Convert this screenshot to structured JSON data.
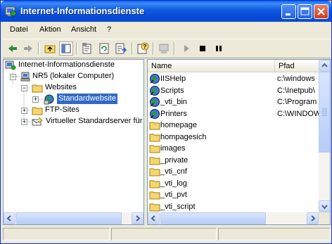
{
  "window": {
    "title": "Internet-Informationsdienste",
    "colors": {
      "titlebar": "#0a4bd0",
      "selection": "#316ac5",
      "folder": "#f7d66b"
    }
  },
  "menu": [
    "Datei",
    "Aktion",
    "Ansicht",
    "?"
  ],
  "tree": [
    {
      "label": "Internet-Informationsdienste",
      "icon": "iis-icon"
    },
    {
      "label": "NR5 (lokaler Computer)",
      "icon": "computer-icon",
      "expander": "−"
    },
    {
      "label": "Websites",
      "icon": "folder-icon",
      "expander": "−"
    },
    {
      "label": "Standardwebsite",
      "icon": "globe-icon",
      "expander": "+",
      "selected": true
    },
    {
      "label": "FTP-Sites",
      "icon": "folder-icon",
      "expander": "+"
    },
    {
      "label": "Virtueller Standardserver für",
      "icon": "smtp-server-icon",
      "expander": "+"
    }
  ],
  "list": {
    "columns": [
      "Name",
      "Pfad"
    ],
    "rows": [
      {
        "name": "IISHelp",
        "path": "c:\\windows",
        "icon": "virtual-dir-icon"
      },
      {
        "name": "Scripts",
        "path": "C:\\Inetpub\\",
        "icon": "virtual-dir-icon"
      },
      {
        "name": "_vti_bin",
        "path": "C:\\Program",
        "icon": "virtual-dir-icon"
      },
      {
        "name": "Printers",
        "path": "C:\\WINDOW",
        "icon": "virtual-dir-icon"
      },
      {
        "name": "homepage",
        "path": "",
        "icon": "folder-icon"
      },
      {
        "name": "hompagesich",
        "path": "",
        "icon": "folder-icon"
      },
      {
        "name": "images",
        "path": "",
        "icon": "folder-icon"
      },
      {
        "name": "_private",
        "path": "",
        "icon": "folder-icon"
      },
      {
        "name": "_vti_cnf",
        "path": "",
        "icon": "folder-icon"
      },
      {
        "name": "_vti_log",
        "path": "",
        "icon": "folder-icon"
      },
      {
        "name": "_vti_pvt",
        "path": "",
        "icon": "folder-icon"
      },
      {
        "name": "_vti_script",
        "path": "",
        "icon": "folder-icon"
      }
    ]
  }
}
